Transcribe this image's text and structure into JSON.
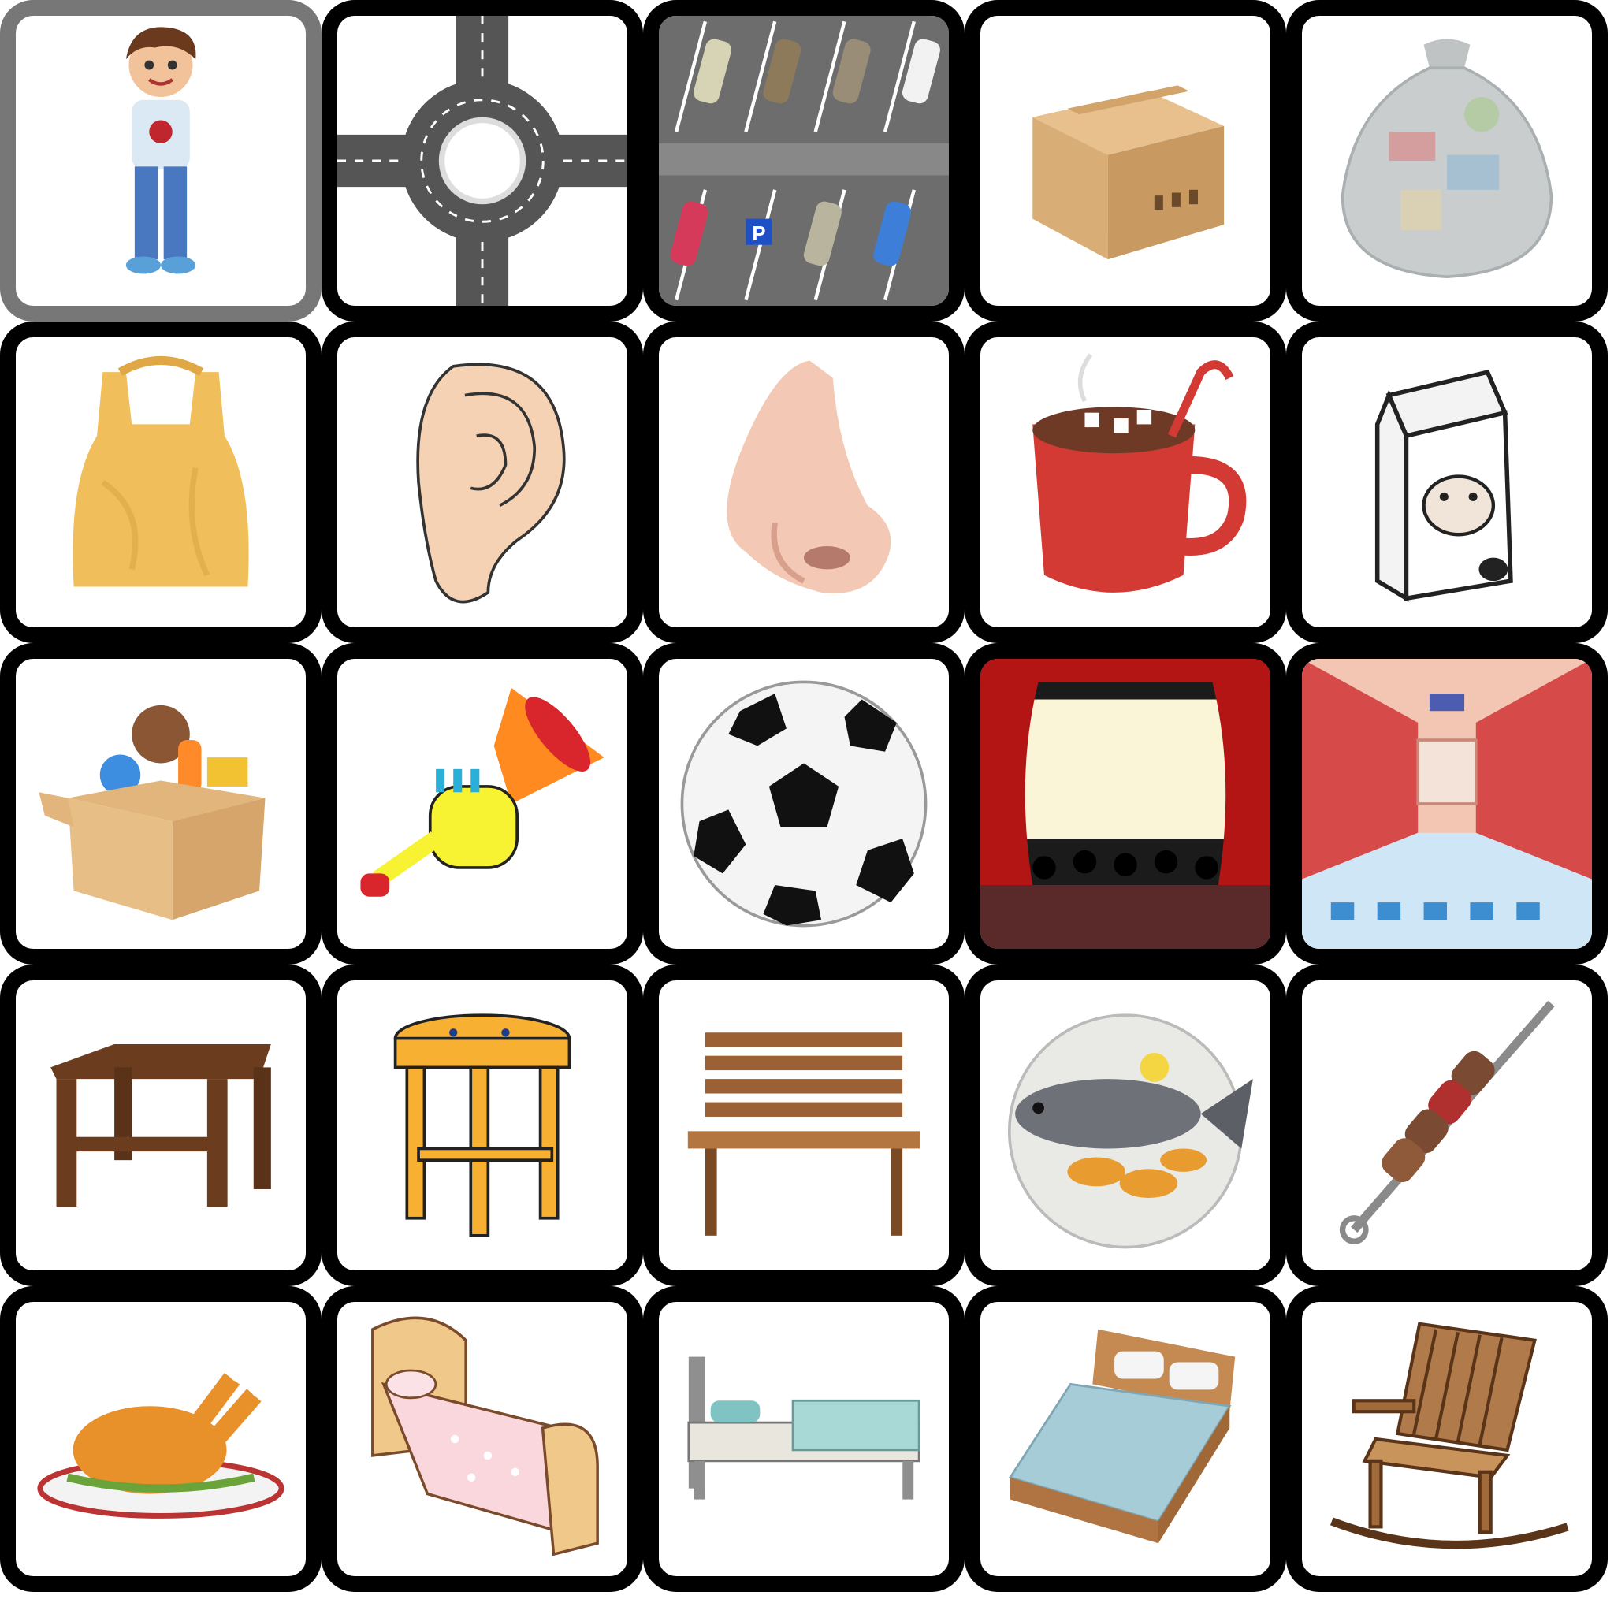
{
  "board": {
    "selected_index": 0,
    "tiles": [
      {
        "icon": "boy-icon"
      },
      {
        "icon": "roundabout-icon"
      },
      {
        "icon": "parking-lot-icon"
      },
      {
        "icon": "cardboard-box-icon"
      },
      {
        "icon": "trash-bag-icon"
      },
      {
        "icon": "plastic-bag-icon"
      },
      {
        "icon": "ear-icon"
      },
      {
        "icon": "nose-icon"
      },
      {
        "icon": "hot-chocolate-icon"
      },
      {
        "icon": "milk-carton-icon"
      },
      {
        "icon": "toy-box-icon"
      },
      {
        "icon": "toy-trumpet-icon"
      },
      {
        "icon": "soccer-ball-icon"
      },
      {
        "icon": "cinema-icon"
      },
      {
        "icon": "supermarket-aisle-icon"
      },
      {
        "icon": "small-table-icon"
      },
      {
        "icon": "stool-icon"
      },
      {
        "icon": "bench-icon"
      },
      {
        "icon": "fish-plate-icon"
      },
      {
        "icon": "kebab-skewer-icon"
      },
      {
        "icon": "roast-chicken-icon"
      },
      {
        "icon": "kids-bed-icon"
      },
      {
        "icon": "single-bed-icon"
      },
      {
        "icon": "double-bed-icon"
      },
      {
        "icon": "rocking-chair-icon"
      }
    ]
  },
  "parking_sign": "P",
  "colors": {
    "tile_border": "#000000",
    "selected_border": "#777777",
    "tile_background": "#ffffff"
  }
}
